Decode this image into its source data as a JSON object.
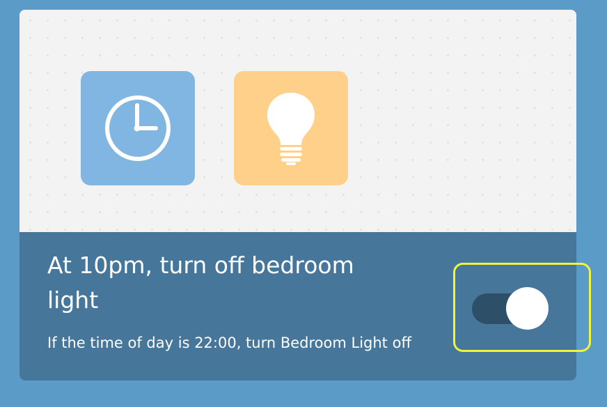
{
  "colors": {
    "page_background": "#5b9bc8",
    "trigger_tile": "#82b6e2",
    "action_tile": "#ffd08a",
    "info_panel": "#46769a",
    "toggle_track": "#2d4f68",
    "highlight": "#f2f43a"
  },
  "applet": {
    "trigger_icon": "clock-icon",
    "action_icon": "light-bulb-icon",
    "title": "At 10pm, turn off bedroom light",
    "description": "If the time of day is 22:00, turn Bedroom Light off",
    "enabled": true
  }
}
